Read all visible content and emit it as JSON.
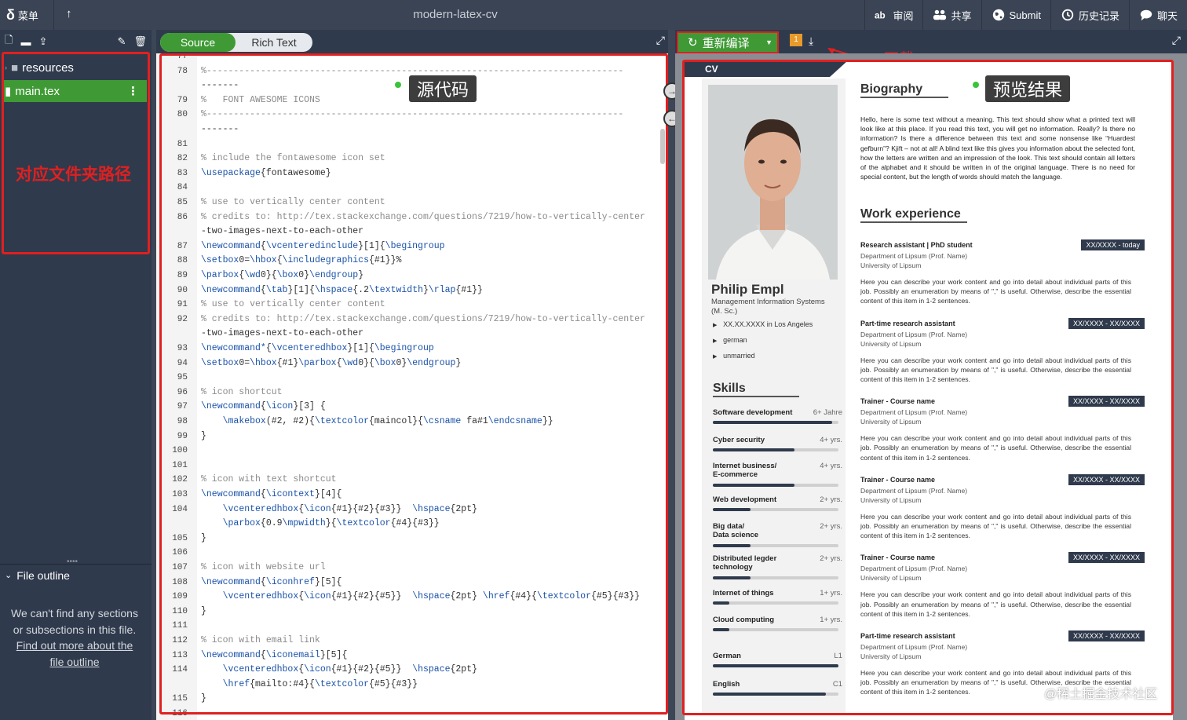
{
  "topbar": {
    "menu_label": "菜单",
    "project_title": "modern-latex-cv",
    "actions": [
      {
        "label": "审阅",
        "icon": "review-icon"
      },
      {
        "label": "共享",
        "icon": "share-icon"
      },
      {
        "label": "Submit",
        "icon": "globe-icon"
      },
      {
        "label": "历史记录",
        "icon": "history-icon"
      },
      {
        "label": "聊天",
        "icon": "chat-icon"
      }
    ]
  },
  "file_tree": {
    "items": [
      {
        "label": "resources",
        "type": "folder"
      },
      {
        "label": "main.tex",
        "type": "file",
        "selected": true
      }
    ],
    "annotation": "对应文件夹路径"
  },
  "outline": {
    "title": "File outline",
    "message": "We can't find any sections or subsections in this file.",
    "link": "Find out more about the file outline"
  },
  "editor": {
    "mode_source": "Source",
    "mode_rich": "Rich Text",
    "annotation": "源代码",
    "lines": [
      {
        "n": "77",
        "code": "",
        "y": 0
      },
      {
        "n": "78",
        "code": "%-----------------------------------------------------------------------------",
        "y": 1
      },
      {
        "n": "",
        "code": "-------",
        "y": 2
      },
      {
        "n": "79",
        "code": "%   FONT AWESOME ICONS",
        "y": 3
      },
      {
        "n": "80",
        "code": "%-----------------------------------------------------------------------------",
        "y": 4
      },
      {
        "n": "",
        "code": "-------",
        "y": 5
      },
      {
        "n": "81",
        "code": "",
        "y": 6
      },
      {
        "n": "82",
        "code": "% include the fontawesome icon set",
        "y": 7
      },
      {
        "n": "83",
        "code": "\\usepackage{fontawesome}",
        "y": 8
      },
      {
        "n": "84",
        "code": "",
        "y": 9
      },
      {
        "n": "85",
        "code": "% use to vertically center content",
        "y": 10
      },
      {
        "n": "86",
        "code": "% credits to: http://tex.stackexchange.com/questions/7219/how-to-vertically-center",
        "y": 11
      },
      {
        "n": "",
        "code": "-two-images-next-to-each-other",
        "y": 12
      },
      {
        "n": "87",
        "code": "\\newcommand{\\vcenteredinclude}[1]{\\begingroup",
        "y": 13
      },
      {
        "n": "88",
        "code": "\\setbox0=\\hbox{\\includegraphics{#1}}%",
        "y": 14
      },
      {
        "n": "89",
        "code": "\\parbox{\\wd0}{\\box0}\\endgroup}",
        "y": 15
      },
      {
        "n": "90",
        "code": "\\newcommand{\\tab}[1]{\\hspace{.2\\textwidth}\\rlap{#1}}",
        "y": 16
      },
      {
        "n": "91",
        "code": "% use to vertically center content",
        "y": 17
      },
      {
        "n": "92",
        "code": "% credits to: http://tex.stackexchange.com/questions/7219/how-to-vertically-center",
        "y": 18
      },
      {
        "n": "",
        "code": "-two-images-next-to-each-other",
        "y": 19
      },
      {
        "n": "93",
        "code": "\\newcommand*{\\vcenteredhbox}[1]{\\begingroup",
        "y": 20
      },
      {
        "n": "94",
        "code": "\\setbox0=\\hbox{#1}\\parbox{\\wd0}{\\box0}\\endgroup}",
        "y": 21
      },
      {
        "n": "95",
        "code": "",
        "y": 22
      },
      {
        "n": "96",
        "code": "% icon shortcut",
        "y": 23
      },
      {
        "n": "97",
        "code": "\\newcommand{\\icon}[3] {",
        "y": 24
      },
      {
        "n": "98",
        "code": "    \\makebox(#2, #2){\\textcolor{maincol}{\\csname fa#1\\endcsname}}",
        "y": 25
      },
      {
        "n": "99",
        "code": "}",
        "y": 26
      },
      {
        "n": "100",
        "code": "",
        "y": 27
      },
      {
        "n": "101",
        "code": "",
        "y": 28
      },
      {
        "n": "102",
        "code": "% icon with text shortcut",
        "y": 29
      },
      {
        "n": "103",
        "code": "\\newcommand{\\icontext}[4]{",
        "y": 30
      },
      {
        "n": "104",
        "code": "    \\vcenteredhbox{\\icon{#1}{#2}{#3}}  \\hspace{2pt}",
        "y": 31
      },
      {
        "n": "",
        "code": "    \\parbox{0.9\\mpwidth}{\\textcolor{#4}{#3}}",
        "y": 32
      },
      {
        "n": "105",
        "code": "}",
        "y": 33
      },
      {
        "n": "106",
        "code": "",
        "y": 34
      },
      {
        "n": "107",
        "code": "% icon with website url",
        "y": 35
      },
      {
        "n": "108",
        "code": "\\newcommand{\\iconhref}[5]{",
        "y": 36
      },
      {
        "n": "109",
        "code": "    \\vcenteredhbox{\\icon{#1}{#2}{#5}}  \\hspace{2pt} \\href{#4}{\\textcolor{#5}{#3}}",
        "y": 37
      },
      {
        "n": "110",
        "code": "}",
        "y": 38
      },
      {
        "n": "111",
        "code": "",
        "y": 39
      },
      {
        "n": "112",
        "code": "% icon with email link",
        "y": 40
      },
      {
        "n": "113",
        "code": "\\newcommand{\\iconemail}[5]{",
        "y": 41
      },
      {
        "n": "114",
        "code": "    \\vcenteredhbox{\\icon{#1}{#2}{#5}}  \\hspace{2pt}",
        "y": 42
      },
      {
        "n": "",
        "code": "    \\href{mailto:#4}{\\textcolor{#5}{#3}}",
        "y": 43
      },
      {
        "n": "115",
        "code": "}",
        "y": 44
      },
      {
        "n": "116",
        "code": "",
        "y": 45
      }
    ]
  },
  "pdf": {
    "recompile_label": "重新编译",
    "log_badge": "1",
    "download_annotation": "下载",
    "preview_annotation": "预览结果",
    "cv": {
      "tab": "CV",
      "name": "Philip Empl",
      "position": "Management Information Systems (M. Sc.)",
      "facts": [
        "XX.XX.XXXX in Los Angeles",
        "german",
        "unmarried"
      ],
      "skills_title": "Skills",
      "skills": [
        {
          "name": "Software development",
          "yrs": "6+ Jahre",
          "level": 0.95
        },
        {
          "name": "Cyber security",
          "yrs": "4+ yrs.",
          "level": 0.65
        },
        {
          "name": "Internet business/\nE-commerce",
          "yrs": "4+ yrs.",
          "level": 0.65
        },
        {
          "name": "Web development",
          "yrs": "2+ yrs.",
          "level": 0.3
        },
        {
          "name": "Big data/\nData science",
          "yrs": "2+ yrs.",
          "level": 0.3
        },
        {
          "name": "Distributed legder\ntechnology",
          "yrs": "2+ yrs.",
          "level": 0.3
        },
        {
          "name": "Internet of things",
          "yrs": "1+ yrs.",
          "level": 0.13
        },
        {
          "name": "Cloud computing",
          "yrs": "1+ yrs.",
          "level": 0.13
        },
        {
          "name": "German",
          "yrs": "L1",
          "level": 1.0
        },
        {
          "name": "English",
          "yrs": "C1",
          "level": 0.9
        }
      ],
      "bio_title": "Biography",
      "bio": "Hello, here is some text without a meaning. This text should show what a printed text will look like at this place. If you read this text, you will get no information. Really? Is there no information? Is there a difference between this text and some nonsense like “Huardest gefburn”? Kjift – not at all! A blind text like this gives you information about the selected font, how the letters are written and an impression of the look. This text should contain all letters of the alphabet and it should be written in of the original language. There is no need for special content, but the length of words should match the language.",
      "work_title": "Work experience",
      "jobs": [
        {
          "title": "Research assistant | PhD student",
          "date": "XX/XXXX - today",
          "dept": "Department of Lipsum (Prof. Name)",
          "uni": "University of Lipsum"
        },
        {
          "title": "Part-time research assistant",
          "date": "XX/XXXX - XX/XXXX",
          "dept": "Department of Lipsum (Prof. Name)",
          "uni": "University of Lipsum"
        },
        {
          "title": "Trainer - Course name",
          "date": "XX/XXXX - XX/XXXX",
          "dept": "Department of Lipsum (Prof. Name)",
          "uni": "University of Lipsum"
        },
        {
          "title": "Trainer - Course name",
          "date": "XX/XXXX - XX/XXXX",
          "dept": "Department of Lipsum (Prof. Name)",
          "uni": "University of Lipsum"
        },
        {
          "title": "Trainer - Course name",
          "date": "XX/XXXX - XX/XXXX",
          "dept": "Department of Lipsum (Prof. Name)",
          "uni": "University of Lipsum"
        },
        {
          "title": "Part-time research assistant",
          "date": "XX/XXXX - XX/XXXX",
          "dept": "Department of Lipsum (Prof. Name)",
          "uni": "University of Lipsum"
        }
      ],
      "job_text": "Here you can describe your work content and go into detail about individual parts of this job. Possibly an enumeration by means of \",\" is useful. Otherwise, describe the essential content of this item in 1-2 sentences."
    }
  },
  "watermark": "@稀土掘金技术社区"
}
